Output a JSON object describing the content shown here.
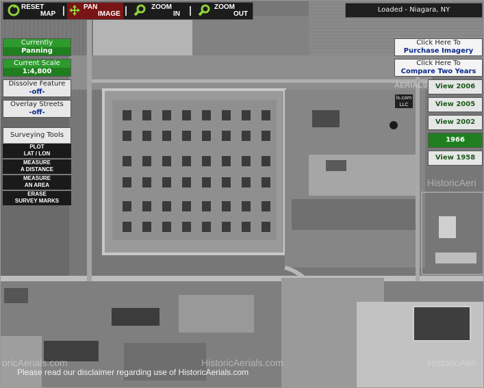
{
  "toolbar": {
    "reset": {
      "l1": "RESET",
      "l2": "MAP",
      "icon": "reset-icon"
    },
    "pan": {
      "l1": "PAN",
      "l2": "IMAGE",
      "icon": "pan-icon"
    },
    "zoom_in": {
      "l1": "ZOOM",
      "l2": "IN",
      "icon": "zoom-in-icon"
    },
    "zoom_out": {
      "l1": "ZOOM",
      "l2": "OUT",
      "icon": "zoom-out-icon"
    }
  },
  "status": "Loaded - Niagara, NY",
  "left_panel": {
    "mode": {
      "label": "Currently",
      "value": "Panning"
    },
    "scale": {
      "label": "Current Scale",
      "value": "1:4,800"
    },
    "dissolve": {
      "label": "Dissolve Feature",
      "value": "-off-"
    },
    "overlay": {
      "label": "Overlay Streets",
      "value": "-off-"
    },
    "surveying_title": "Surveying Tools",
    "tools": [
      {
        "l1": "PLOT",
        "l2": "LAT / LON"
      },
      {
        "l1": "MEASURE",
        "l2": "A DISTANCE"
      },
      {
        "l1": "MEASURE",
        "l2": "AN AREA"
      },
      {
        "l1": "ERASE",
        "l2": "SURVEY MARKS"
      }
    ]
  },
  "right_panel": {
    "purchase": {
      "l1": "Click Here To",
      "l2": "Purchase Imagery"
    },
    "compare": {
      "l1": "Click Here To",
      "l2": "Compare Two Years"
    },
    "years": [
      {
        "label": "View 2006",
        "selected": false
      },
      {
        "label": "View 2005",
        "selected": false
      },
      {
        "label": "View 2002",
        "selected": false
      },
      {
        "label": "1966",
        "selected": true
      },
      {
        "label": "View 1958",
        "selected": false
      }
    ]
  },
  "watermarks": {
    "top_right": "AERIALS",
    "mid_right": "HistoricAeri",
    "bottom_left": "oricAerials.com",
    "bottom_mid": "HistoricAerials.com",
    "bottom_right": "HistoricAeri",
    "badge_l1": "ls.com",
    "badge_l2": "LLC"
  },
  "disclaimer": "Please read our disclaimer regarding use of HistoricAerials.com",
  "colors": {
    "panel_green": "#1f7f1f",
    "link_blue": "#0a2a8a",
    "pan_active": "#7a1515"
  }
}
